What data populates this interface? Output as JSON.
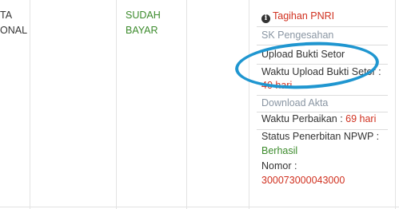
{
  "row": {
    "nama_fragment_1": "TA",
    "nama_fragment_2": "ONAL",
    "status_line_1": "SUDAH",
    "status_line_2": "BAYAR",
    "actions": {
      "tagihan_icon": "info-icon",
      "tagihan_label": "Tagihan PNRI",
      "sk_label": "SK Pengesahan",
      "upload_label": "Upload Bukti Setor",
      "waktu_upload_label": "Waktu Upload Bukti Setor :",
      "waktu_upload_value": "40 hari",
      "download_label": "Download Akta",
      "waktu_perbaikan_label": "Waktu Perbaikan :",
      "waktu_perbaikan_value": "69 hari",
      "npwp_status_label": "Status Penerbitan NPWP :",
      "npwp_status_value": "Berhasil",
      "nomor_label": "Nomor :",
      "nomor_value": "300073000043000"
    }
  },
  "colors": {
    "green": "#3c8b2c",
    "red": "#d0301f",
    "link_grey": "#8a96a3",
    "highlight_circle": "#1f96d0"
  }
}
